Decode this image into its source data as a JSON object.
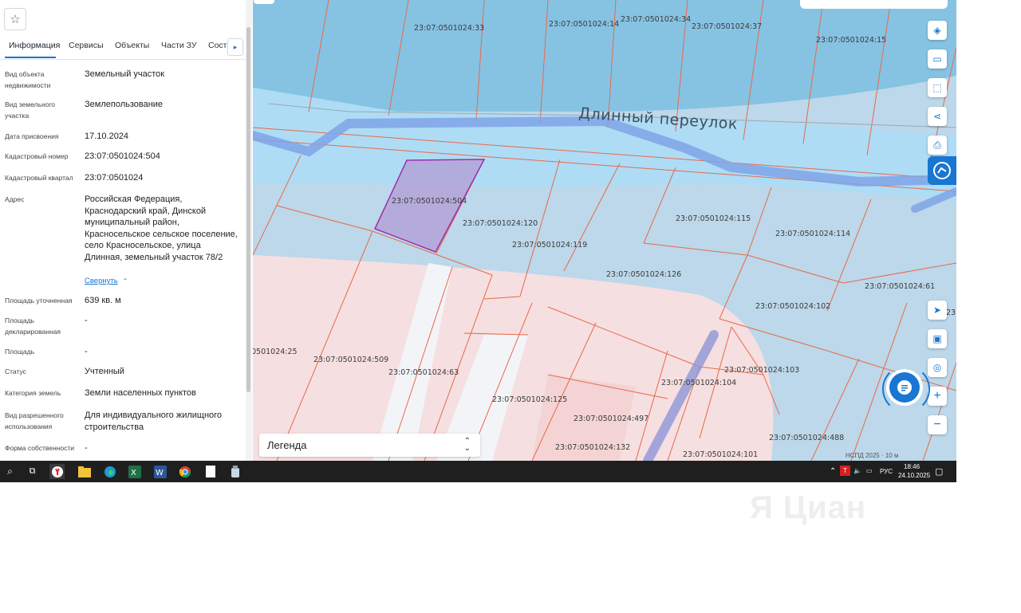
{
  "panel": {
    "tabs": [
      "Информация",
      "Сервисы",
      "Объекты",
      "Части ЗУ",
      "Соста"
    ],
    "fields": [
      {
        "label": "Вид объекта недвижимости",
        "value": "Земельный участок"
      },
      {
        "label": "Вид земельного участка",
        "value": "Землепользование"
      },
      {
        "label": "Дата присвоения",
        "value": "17.10.2024"
      },
      {
        "label": "Кадастровый номер",
        "value": "23:07:0501024:504"
      },
      {
        "label": "Кадастровый квартал",
        "value": "23:07:0501024"
      },
      {
        "label": "Адрес",
        "value": "Российская Федерация, Краснодарский край, Динской муниципальный район, Красносельское сельское поселение, село Красносельское, улица Длинная, земельный участок 78/2"
      },
      {
        "label": "Площадь уточненная",
        "value": "639 кв. м"
      },
      {
        "label": "Площадь декларированная",
        "value": "-"
      },
      {
        "label": "Площадь",
        "value": "-"
      },
      {
        "label": "Статус",
        "value": "Учтенный"
      },
      {
        "label": "Категория земель",
        "value": "Земли населенных пунктов"
      },
      {
        "label": "Вид разрешенного использования",
        "value": "Для индивидуального жилищного строительства"
      },
      {
        "label": "Форма собственности",
        "value": "-"
      }
    ],
    "collapse_label": "Свернуть"
  },
  "map": {
    "street_name": "Длинный переулок",
    "parcels": [
      "23:07:0501024:33",
      "23:07:0501024:14",
      "23:07:0501024:34",
      "23:07:0501024:37",
      "23:07:0501024:15",
      "23:07:0501024:504",
      "23:07:0501024:120",
      "23:07:0501024:119",
      "23:07:0501024:115",
      "23:07:0501024:114",
      "23:07:0501024:126",
      "23:07:0501024:61",
      "23:07:0501024:102",
      "0501024:25",
      "23:07:0501024:509",
      "23:07:0501024:63",
      "23:07:0501024:103",
      "23:07:0501024:104",
      "23:07:0501024:125",
      "23:07:0501024:497",
      "23:07:0501024:488",
      "23:07:0501024:132",
      "23:07:0501024:101",
      "23"
    ],
    "legend_label": "Легенда",
    "attribution": "НСПД 2025",
    "scale": "10 м",
    "colors": {
      "water": "#aedcf5",
      "residential": "#f6dcdc",
      "parcel_border": "#e8694a",
      "selected": "#9b2fae",
      "road": "#7fa4e6"
    }
  },
  "taskbar": {
    "lang": "РУС",
    "time": "18:46",
    "date": "24.10.2025"
  },
  "watermark": "Я Циан"
}
